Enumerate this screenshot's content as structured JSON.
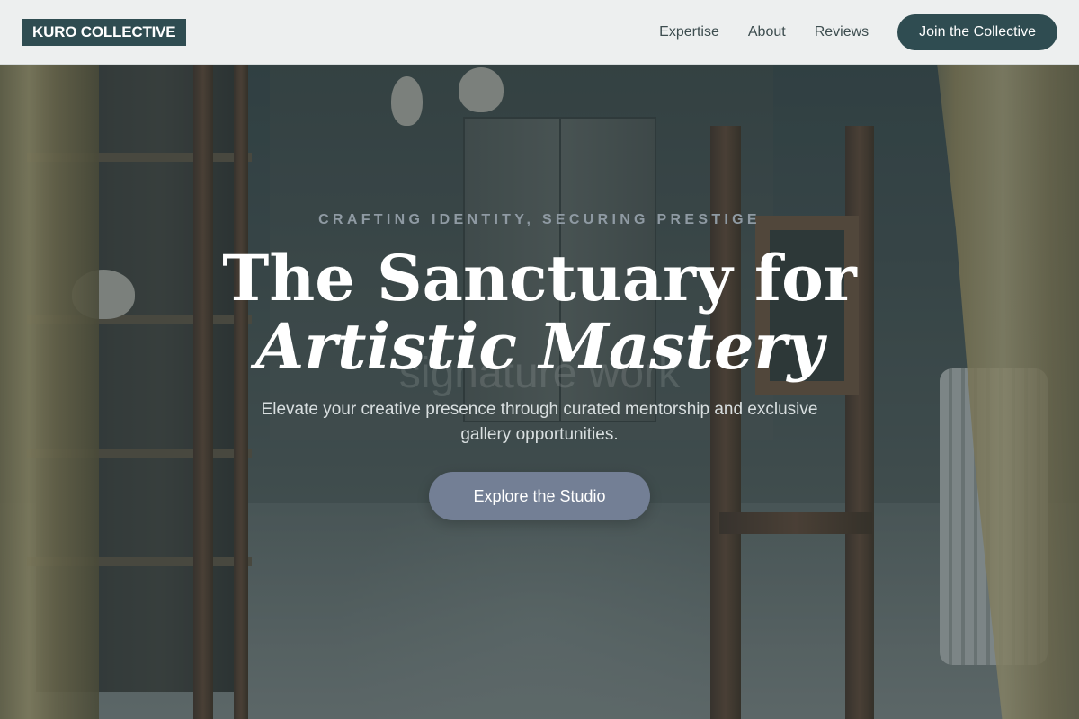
{
  "header": {
    "logo": "KURO COLLECTIVE",
    "nav": [
      "Expertise",
      "About",
      "Reviews"
    ],
    "cta": "Join the Collective"
  },
  "hero": {
    "tagline": "CRAFTING IDENTITY, SECURING PRESTIGE",
    "title_line1": "The Sanctuary for",
    "title_line2": "Artistic Mastery",
    "ghost_text": "signature work",
    "subtitle": "Elevate your creative presence through curated mentorship and exclusive gallery opportunities.",
    "button": "Explore the Studio"
  },
  "colors": {
    "brand": "#2f4c51",
    "button": "#737f95",
    "tagline": "#8f9aa3",
    "header_bg": "#f4f5f5"
  }
}
